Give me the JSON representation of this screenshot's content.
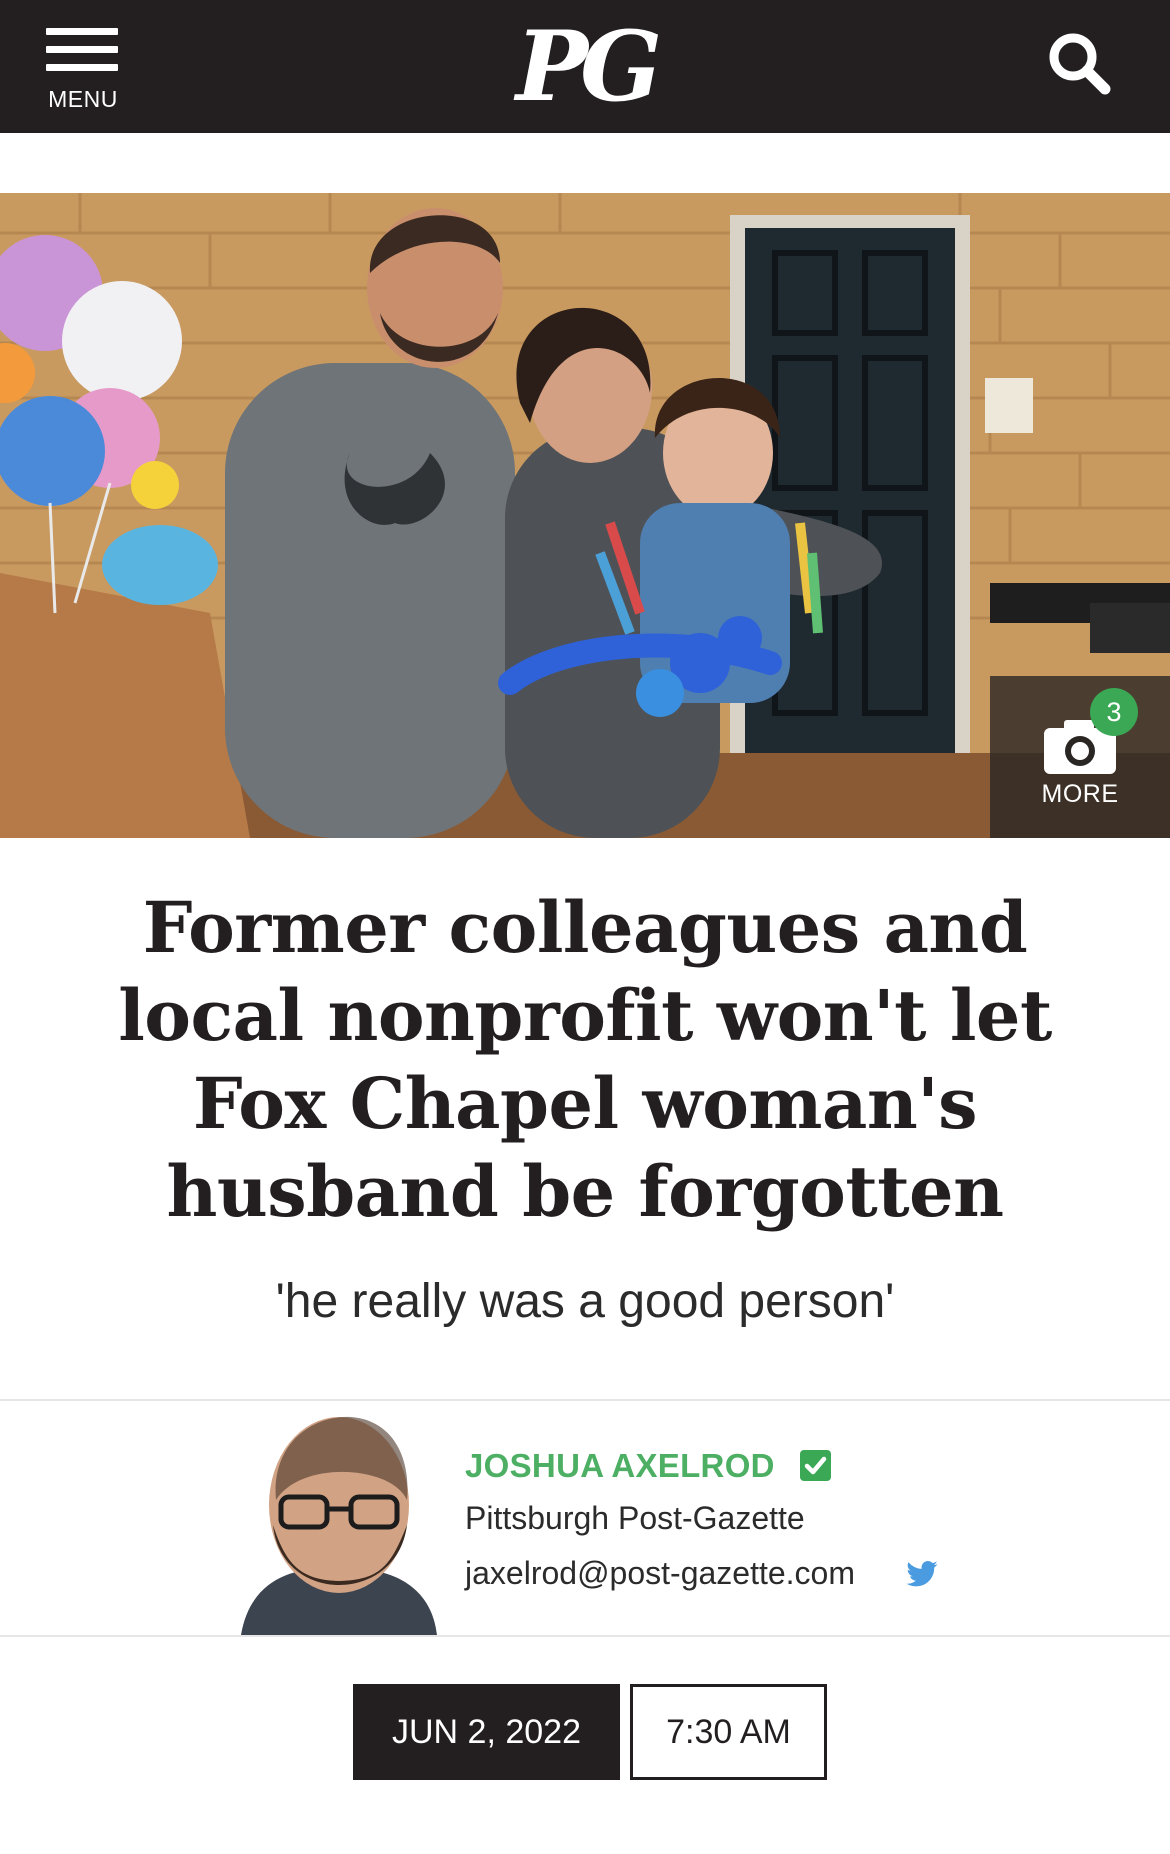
{
  "header": {
    "menu_label": "MENU",
    "logo_text": "PG",
    "background": "#231f20"
  },
  "hero": {
    "more_label": "MORE",
    "photo_count": "3",
    "badge_color": "#3aa855"
  },
  "article": {
    "headline": "Former colleagues and local nonprofit won't let Fox Chapel woman's husband be forgotten",
    "dek": "'he really was a good person'"
  },
  "byline": {
    "author": "JOSHUA AXELROD",
    "organization": "Pittsburgh Post-Gazette",
    "email": "jaxelrod@post-gazette.com",
    "author_color": "#4caf63"
  },
  "dateline": {
    "date": "JUN 2, 2022",
    "time": "7:30 AM"
  },
  "icons": [
    "menu-icon",
    "search-icon",
    "camera-icon",
    "verified-check-icon",
    "twitter-icon"
  ]
}
